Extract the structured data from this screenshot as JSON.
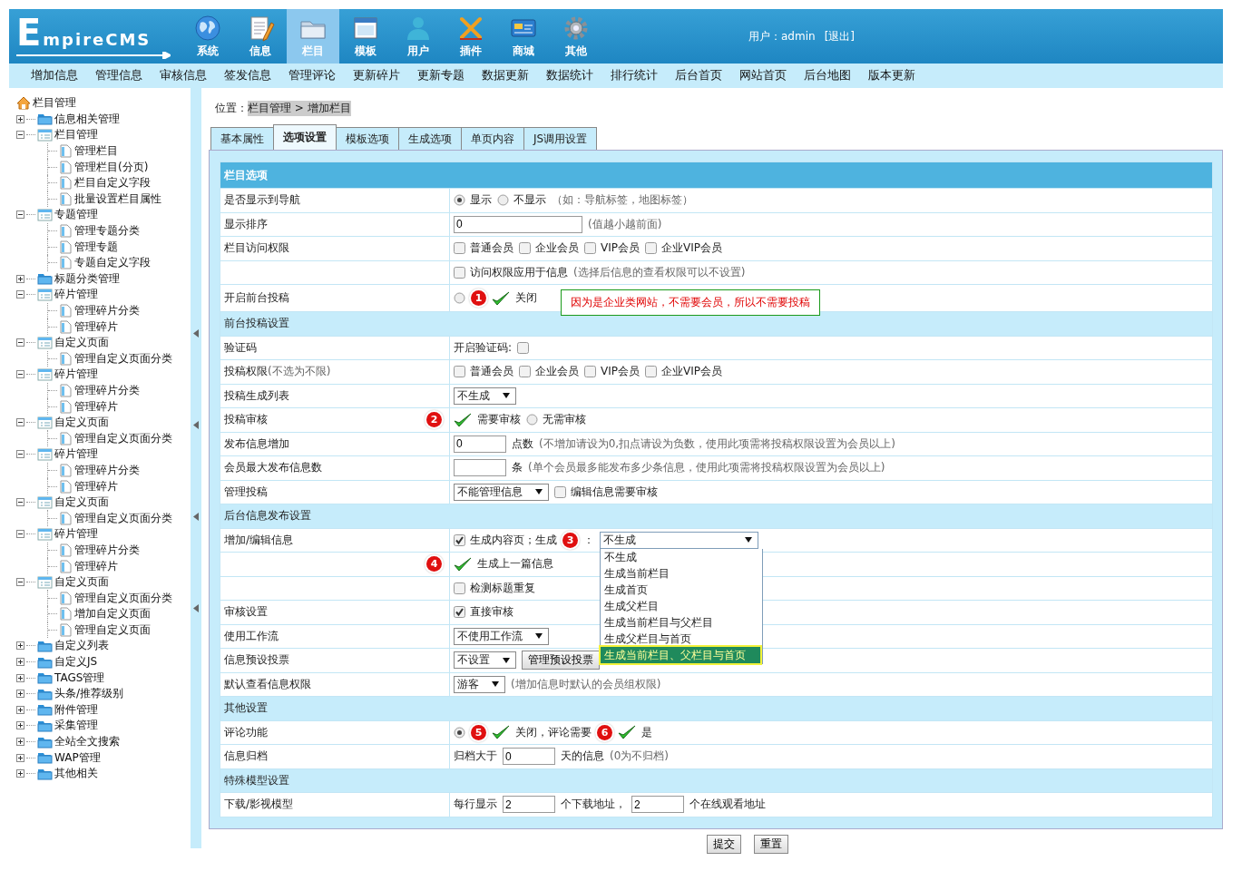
{
  "header": {
    "logo": "EmpireCMS",
    "nav": [
      {
        "label": "系统",
        "selected": false
      },
      {
        "label": "信息",
        "selected": false
      },
      {
        "label": "栏目",
        "selected": true
      },
      {
        "label": "模板",
        "selected": false
      },
      {
        "label": "用户",
        "selected": false
      },
      {
        "label": "插件",
        "selected": false
      },
      {
        "label": "商城",
        "selected": false
      },
      {
        "label": "其他",
        "selected": false
      }
    ],
    "user": "用户：admin",
    "logout": "[退出]"
  },
  "submenu": [
    "增加信息",
    "管理信息",
    "审核信息",
    "签发信息",
    "管理评论",
    "更新碎片",
    "更新专题",
    "数据更新",
    "数据统计",
    "排行统计",
    "后台首页",
    "网站首页",
    "后台地图",
    "版本更新"
  ],
  "sidebar": {
    "root": "栏目管理",
    "items": [
      {
        "label": "信息相关管理",
        "expanded": false
      },
      {
        "label": "栏目管理",
        "expanded": true,
        "children": [
          {
            "label": "管理栏目"
          },
          {
            "label": "管理栏目(分页)"
          },
          {
            "label": "栏目自定义字段"
          },
          {
            "label": "批量设置栏目属性"
          }
        ]
      },
      {
        "label": "专题管理",
        "expanded": true,
        "children": [
          {
            "label": "管理专题分类"
          },
          {
            "label": "管理专题"
          },
          {
            "label": "专题自定义字段"
          }
        ]
      },
      {
        "label": "标题分类管理",
        "expanded": false
      },
      {
        "label": "碎片管理",
        "expanded": true,
        "children": [
          {
            "label": "管理碎片分类"
          },
          {
            "label": "管理碎片"
          }
        ]
      },
      {
        "label": "自定义页面",
        "expanded": true,
        "children": [
          {
            "label": "管理自定义页面分类"
          }
        ]
      },
      {
        "label": "碎片管理",
        "expanded": true,
        "children": [
          {
            "label": "管理碎片分类"
          },
          {
            "label": "管理碎片"
          }
        ]
      },
      {
        "label": "自定义页面",
        "expanded": true,
        "children": [
          {
            "label": "管理自定义页面分类"
          }
        ]
      },
      {
        "label": "碎片管理",
        "expanded": true,
        "children": [
          {
            "label": "管理碎片分类"
          },
          {
            "label": "管理碎片"
          }
        ]
      },
      {
        "label": "自定义页面",
        "expanded": true,
        "children": [
          {
            "label": "管理自定义页面分类"
          }
        ]
      },
      {
        "label": "碎片管理",
        "expanded": true,
        "children": [
          {
            "label": "管理碎片分类"
          },
          {
            "label": "管理碎片"
          }
        ]
      },
      {
        "label": "自定义页面",
        "expanded": true,
        "children": [
          {
            "label": "管理自定义页面分类"
          },
          {
            "label": "增加自定义页面"
          },
          {
            "label": "管理自定义页面"
          }
        ]
      },
      {
        "label": "自定义列表",
        "expanded": false
      },
      {
        "label": "自定义JS",
        "expanded": false
      },
      {
        "label": "TAGS管理",
        "expanded": false
      },
      {
        "label": "头条/推荐级别",
        "expanded": false
      },
      {
        "label": "附件管理",
        "expanded": false
      },
      {
        "label": "采集管理",
        "expanded": false
      },
      {
        "label": "全站全文搜索",
        "expanded": false
      },
      {
        "label": "WAP管理",
        "expanded": false
      },
      {
        "label": "其他相关",
        "expanded": false
      }
    ]
  },
  "breadcrumb": {
    "label": "位置：",
    "path": "栏目管理 > 增加栏目"
  },
  "tabs": [
    {
      "label": "基本属性",
      "selected": false
    },
    {
      "label": "选项设置",
      "selected": true
    },
    {
      "label": "模板选项",
      "selected": false
    },
    {
      "label": "生成选项",
      "selected": false
    },
    {
      "label": "单页内容",
      "selected": false
    },
    {
      "label": "JS调用设置",
      "selected": false
    }
  ],
  "form": {
    "title": "栏目选项",
    "rows": [
      {
        "kind": "field",
        "label": "是否显示到导航",
        "controls": [
          {
            "kind": "radio",
            "label": "显示",
            "selected": true
          },
          {
            "kind": "radio",
            "label": "不显示",
            "selected": false
          },
          {
            "kind": "hint",
            "text": "（如：导航标签，地图标签）"
          }
        ]
      },
      {
        "kind": "field",
        "label": "显示排序",
        "controls": [
          {
            "kind": "wide-input",
            "value": "0"
          },
          {
            "kind": "hint",
            "text": "(值越小越前面)"
          }
        ]
      },
      {
        "kind": "field",
        "label": "栏目访问权限",
        "controls": [
          {
            "kind": "checkbox",
            "label": "普通会员",
            "checked": false
          },
          {
            "kind": "checkbox",
            "label": "企业会员",
            "checked": false
          },
          {
            "kind": "checkbox",
            "label": "VIP会员",
            "checked": false
          },
          {
            "kind": "checkbox",
            "label": "企业VIP会员",
            "checked": false
          }
        ]
      },
      {
        "kind": "field",
        "controls": [
          {
            "kind": "checkbox",
            "label": "访问权限应用于信息",
            "checked": false
          },
          {
            "kind": "hint",
            "text": "(选择后信息的查看权限可以不设置)"
          }
        ]
      },
      {
        "kind": "field",
        "label": "开启前台投稿",
        "controls": [
          {
            "kind": "radio",
            "selected": false
          },
          {
            "kind": "badge",
            "text": "1"
          },
          {
            "kind": "check-mark"
          },
          {
            "kind": "text",
            "text": "关闭"
          },
          {
            "kind": "note",
            "text": "因为是企业类网站，不需要会员，所以不需要投稿"
          }
        ]
      },
      {
        "kind": "section",
        "label": "前台投稿设置"
      },
      {
        "kind": "field",
        "label": "验证码",
        "controls": [
          {
            "kind": "text",
            "text": "开启验证码:"
          },
          {
            "kind": "checkbox",
            "checked": false
          }
        ]
      },
      {
        "kind": "field",
        "label": "投稿权限",
        "label_hint": "(不选为不限)",
        "controls": [
          {
            "kind": "checkbox",
            "label": "普通会员",
            "checked": false
          },
          {
            "kind": "checkbox",
            "label": "企业会员",
            "checked": false
          },
          {
            "kind": "checkbox",
            "label": "VIP会员",
            "checked": false
          },
          {
            "kind": "checkbox",
            "label": "企业VIP会员",
            "checked": false
          }
        ]
      },
      {
        "kind": "field",
        "label": "投稿生成列表",
        "controls": [
          {
            "kind": "select",
            "value": "不生成"
          }
        ]
      },
      {
        "kind": "field",
        "label": "投稿审核",
        "badge": "2",
        "controls": [
          {
            "kind": "check-mark"
          },
          {
            "kind": "text",
            "text": "需要审核"
          },
          {
            "kind": "radio",
            "label": "无需审核",
            "selected": false
          }
        ]
      },
      {
        "kind": "field",
        "label": "发布信息增加",
        "controls": [
          {
            "kind": "input",
            "value": "0"
          },
          {
            "kind": "text",
            "text": "点数"
          },
          {
            "kind": "hint",
            "text": "(不增加请设为0,扣点请设为负数，使用此项需将投稿权限设置为会员以上)"
          }
        ]
      },
      {
        "kind": "field",
        "label": "会员最大发布信息数",
        "controls": [
          {
            "kind": "input"
          },
          {
            "kind": "text",
            "text": "条"
          },
          {
            "kind": "hint",
            "text": "(单个会员最多能发布多少条信息，使用此项需将投稿权限设置为会员以上)"
          }
        ]
      },
      {
        "kind": "field",
        "label": "管理投稿",
        "controls": [
          {
            "kind": "select",
            "value": "不能管理信息"
          },
          {
            "kind": "checkbox",
            "label": "编辑信息需要审核",
            "checked": false
          }
        ]
      },
      {
        "kind": "section",
        "label": "后台信息发布设置"
      },
      {
        "kind": "field",
        "label": "增加/编辑信息",
        "controls": [
          {
            "kind": "checkbox",
            "label": "生成内容页；生成",
            "checked": true
          },
          {
            "kind": "badge",
            "text": "3"
          },
          {
            "kind": "text",
            "text": "："
          },
          {
            "kind": "select",
            "value": "不生成",
            "expanded": true,
            "options": [
              {
                "label": "不生成",
                "highlighted": false
              },
              {
                "label": "生成当前栏目",
                "highlighted": false
              },
              {
                "label": "生成首页",
                "highlighted": false
              },
              {
                "label": "生成父栏目",
                "highlighted": false
              },
              {
                "label": "生成当前栏目与父栏目",
                "highlighted": false
              },
              {
                "label": "生成父栏目与首页",
                "highlighted": false
              },
              {
                "label": "生成当前栏目、父栏目与首页",
                "highlighted": true
              }
            ]
          }
        ]
      },
      {
        "kind": "field",
        "badge": "4",
        "controls": [
          {
            "kind": "check-mark"
          },
          {
            "kind": "text",
            "text": "生成上一篇信息"
          }
        ]
      },
      {
        "kind": "field",
        "controls": [
          {
            "kind": "checkbox",
            "label": "检测标题重复",
            "checked": false
          }
        ]
      },
      {
        "kind": "field",
        "label": "审核设置",
        "controls": [
          {
            "kind": "checkbox",
            "label": "直接审核",
            "checked": true
          }
        ]
      },
      {
        "kind": "field",
        "label": "使用工作流",
        "controls": [
          {
            "kind": "select",
            "value": "不使用工作流"
          }
        ]
      },
      {
        "kind": "field",
        "label": "信息预设投票",
        "controls": [
          {
            "kind": "select",
            "value": "不设置"
          },
          {
            "kind": "button",
            "label": "管理预设投票"
          }
        ]
      },
      {
        "kind": "field",
        "label": "默认查看信息权限",
        "controls": [
          {
            "kind": "select",
            "value": "游客"
          },
          {
            "kind": "hint",
            "text": "(增加信息时默认的会员组权限)"
          }
        ]
      },
      {
        "kind": "section",
        "label": "其他设置"
      },
      {
        "kind": "field",
        "label": "评论功能",
        "controls": [
          {
            "kind": "radio",
            "selected": true
          },
          {
            "kind": "badge",
            "text": "5"
          },
          {
            "kind": "check-mark"
          },
          {
            "kind": "text",
            "text": "关闭，评论需要"
          },
          {
            "kind": "badge",
            "text": "6"
          },
          {
            "kind": "check-mark"
          },
          {
            "kind": "text",
            "text": "是"
          }
        ]
      },
      {
        "kind": "field",
        "label": "信息归档",
        "controls": [
          {
            "kind": "text",
            "text": "归档大于"
          },
          {
            "kind": "input",
            "value": "0"
          },
          {
            "kind": "text",
            "text": "天的信息"
          },
          {
            "kind": "hint",
            "text": "(0为不归档)"
          }
        ]
      },
      {
        "kind": "section",
        "label": "特殊模型设置"
      },
      {
        "kind": "field",
        "label": "下载/影视模型",
        "controls": [
          {
            "kind": "text",
            "text": "每行显示"
          },
          {
            "kind": "input",
            "value": "2"
          },
          {
            "kind": "text",
            "text": "个下载地址，"
          },
          {
            "kind": "input",
            "value": "2"
          },
          {
            "kind": "text",
            "text": "个在线观看地址"
          }
        ]
      }
    ]
  },
  "buttons": [
    "提交",
    "重置"
  ]
}
